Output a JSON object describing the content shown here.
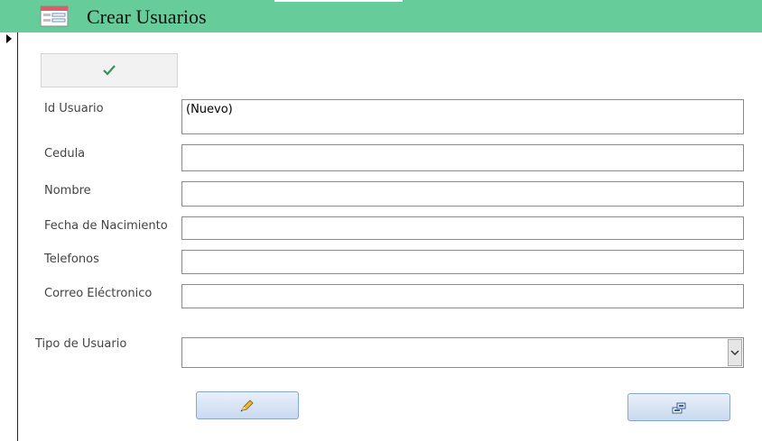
{
  "window": {
    "title": "Crear Usuarios",
    "form_icon": "form-icon",
    "header_color": "#66cc99"
  },
  "record_selector": {
    "icon": "current-record-arrow-icon"
  },
  "toolbar": {
    "check_button_icon": "check-icon",
    "check_color": "#3a8f5a"
  },
  "fields": {
    "id_usuario": {
      "label": "Id Usuario",
      "value": "(Nuevo)"
    },
    "cedula": {
      "label": "Cedula",
      "value": ""
    },
    "nombre": {
      "label": "Nombre",
      "value": ""
    },
    "fecha_nacimiento": {
      "label": "Fecha de Nacimiento",
      "value": ""
    },
    "telefonos": {
      "label": "Telefonos",
      "value": ""
    },
    "correo": {
      "label": "Correo Eléctronico",
      "value": ""
    },
    "tipo_usuario": {
      "label": "Tipo de Usuario",
      "value": "",
      "dropdown_icon": "chevron-down-icon"
    }
  },
  "actions": {
    "edit_button_icon": "pencil-icon",
    "save_button_icon": "save-record-icon"
  }
}
